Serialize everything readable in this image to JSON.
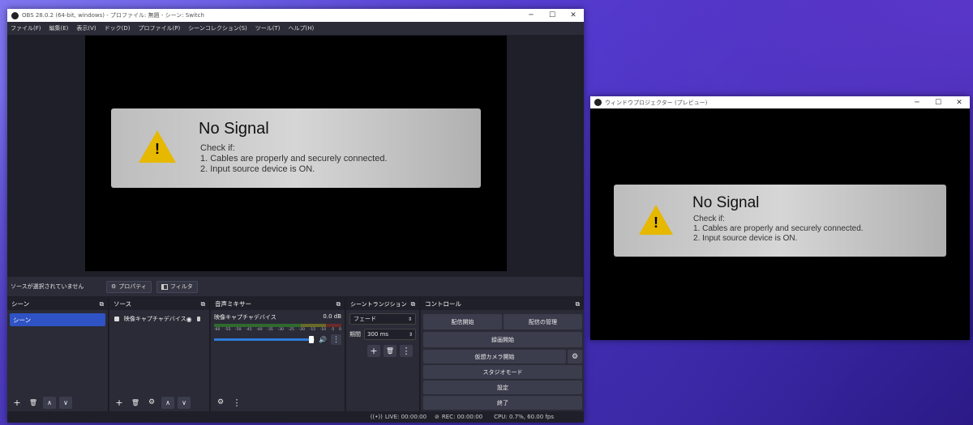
{
  "obs": {
    "title": "OBS 28.0.2 (64-bit, windows) - プロファイル: 無題 - シーン: Switch",
    "menu": [
      "ファイル(F)",
      "編集(E)",
      "表示(V)",
      "ドック(D)",
      "プロファイル(P)",
      "シーンコレクション(S)",
      "ツール(T)",
      "ヘルプ(H)"
    ],
    "no_source": "ソースが選択されていません",
    "properties": "プロパティ",
    "filters": "フィルタ",
    "docks": {
      "scenes": {
        "title": "シーン",
        "items": [
          "シーン"
        ]
      },
      "sources": {
        "title": "ソース",
        "items": [
          "映像キャプチャデバイス"
        ]
      },
      "mixer": {
        "title": "音声ミキサー",
        "channel": "映像キャプチャデバイス",
        "level": "0.0 dB",
        "ticks": [
          "-60",
          "-55",
          "-50",
          "-45",
          "-40",
          "-35",
          "-30",
          "-25",
          "-20",
          "-15",
          "-10",
          "-5",
          "0"
        ],
        "volume": 0.97
      },
      "transitions": {
        "title": "シーントランジション",
        "type": "フェード",
        "duration_label": "期間",
        "duration": "300 ms"
      },
      "controls": {
        "title": "コントロール",
        "start_stream": "配信開始",
        "manage_stream": "配信の管理",
        "start_record": "録画開始",
        "virtual_cam": "仮想カメラ開始",
        "studio_mode": "スタジオモード",
        "settings": "設定",
        "exit": "終了"
      }
    },
    "status": {
      "live": "LIVE: 00:00:00",
      "rec": "REC: 00:00:00",
      "cpu": "CPU: 0.7%, 60.00 fps"
    }
  },
  "projector": {
    "title": "ウィンドウプロジェクター (プレビュー)"
  },
  "signal": {
    "heading": "No Signal",
    "check": "Check if:",
    "line1": "1. Cables are properly and securely connected.",
    "line2": "2. Input source device is ON."
  },
  "icons": {
    "warning": "!",
    "gear": "⚙",
    "eye": "◉",
    "lock": "🔒",
    "speaker": "🔊",
    "menu": "⋮",
    "plus": "+",
    "trash": "🗑",
    "up": "∧",
    "down": "∨",
    "minimize": "─",
    "maximize": "☐",
    "close": "✕",
    "float": "⧉"
  },
  "colors": {
    "accent": "#2f53c4",
    "panel": "#2a2b36",
    "button": "#3b3d4d"
  }
}
